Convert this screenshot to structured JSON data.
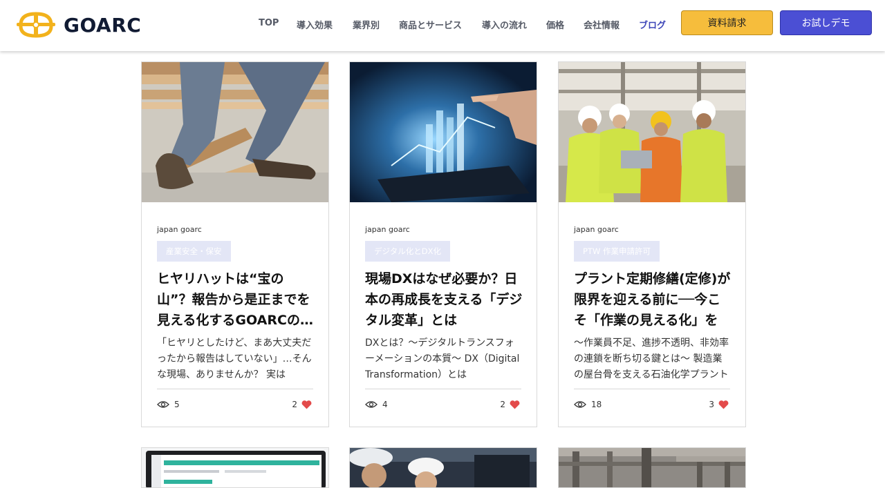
{
  "brand": {
    "name": "GOARC",
    "colors": {
      "logo_gold": "#f2b21c",
      "logo_navy": "#111b33"
    }
  },
  "nav": {
    "items": [
      {
        "label": "TOP"
      },
      {
        "label": "導入効果"
      },
      {
        "label": "業界別"
      },
      {
        "label": "商品とサービス"
      },
      {
        "label": "導入の流れ"
      },
      {
        "label": "価格"
      },
      {
        "label": "会社情報"
      },
      {
        "label": "ブログ",
        "active": true
      }
    ],
    "request_button": "資料請求",
    "demo_button": "お試しデモ",
    "colors": {
      "active": "#3c45b8",
      "request": "#f6bd3c",
      "demo": "#4b4fd4"
    }
  },
  "posts": [
    {
      "author": "japan goarc",
      "tag": "産業安全・保安",
      "title": "ヒヤリハットは“宝の山”？報告から是正までを見える化するGOARCの活用法",
      "excerpt": "「ヒヤリとしたけど、まあ大丈夫だったから報告はしていない」…そんな現場、ありませんか？ 実は",
      "views": "5",
      "likes": "2"
    },
    {
      "author": "japan goarc",
      "tag": "デジタル化とDX化",
      "title": "現場DXはなぜ必要か？日本の再成長を支える「デジタル変革」とは",
      "excerpt": "DXとは？〜デジタルトランスフォーメーションの本質〜 DX（Digital Transformation）とは",
      "views": "4",
      "likes": "2"
    },
    {
      "author": "japan goarc",
      "tag": "PTW 作業申請許可",
      "title": "プラント定期修繕(定修)が限界を迎える前に──今こそ「作業の見える化」を",
      "excerpt": "〜作業員不足、進捗不透明、非効率の連鎖を断ち切る鍵とは〜 製造業の屋台骨を支える石油化学プラント",
      "views": "18",
      "likes": "3"
    }
  ],
  "icons": {
    "views": "eye-icon",
    "likes": "heart-icon",
    "heart_color": "#e34b4b"
  }
}
